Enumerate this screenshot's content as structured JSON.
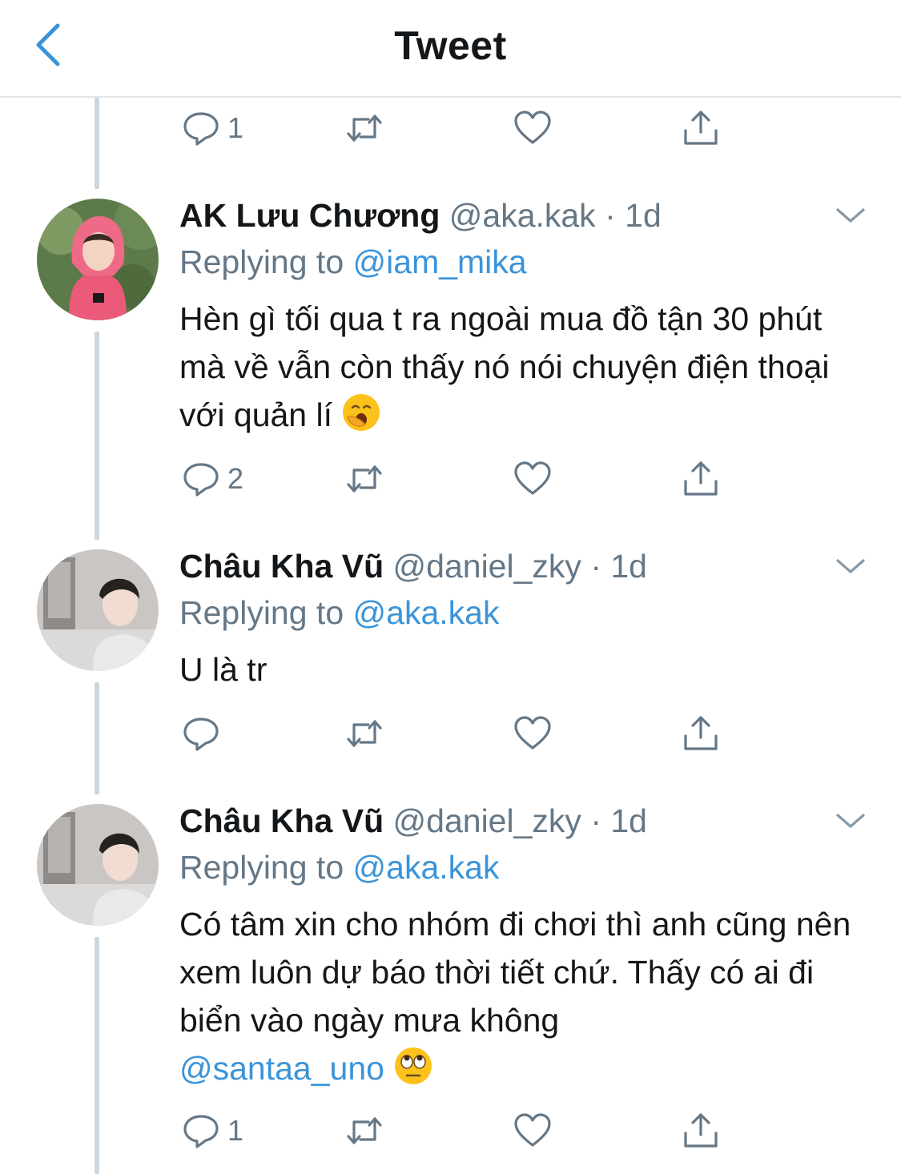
{
  "nav": {
    "title": "Tweet"
  },
  "top_actions": {
    "reply_count": "1"
  },
  "tweets": [
    {
      "name": "AK Lưu Chương",
      "handle": "@aka.kak",
      "sep": "·",
      "time": "1d",
      "replying_prefix": "Replying to",
      "replying_to": "@iam_mika",
      "text": "Hèn gì tối qua t ra ngoài mua đồ tận 30 phút mà về vẫn còn thấy nó nói chuyện điện thoại với quản lí",
      "emoji": "yawning-face",
      "reply_count": "2"
    },
    {
      "name": "Châu Kha Vũ",
      "handle": "@daniel_zky",
      "sep": "·",
      "time": "1d",
      "replying_prefix": "Replying to",
      "replying_to": "@aka.kak",
      "text": "U là tr",
      "reply_count": ""
    },
    {
      "name": "Châu Kha Vũ",
      "handle": "@daniel_zky",
      "sep": "·",
      "time": "1d",
      "replying_prefix": "Replying to",
      "replying_to": "@aka.kak",
      "text": "Có tâm xin cho nhóm đi chơi thì anh cũng nên xem luôn dự báo thời tiết chứ. Thấy có ai đi biển vào ngày mưa không",
      "mention": "@santaa_uno",
      "emoji": "face-with-rolling-eyes",
      "reply_count": "1"
    }
  ],
  "colors": {
    "accent": "#3b94d9",
    "secondary_text": "#657786",
    "thread_line": "#ccd6dd"
  }
}
